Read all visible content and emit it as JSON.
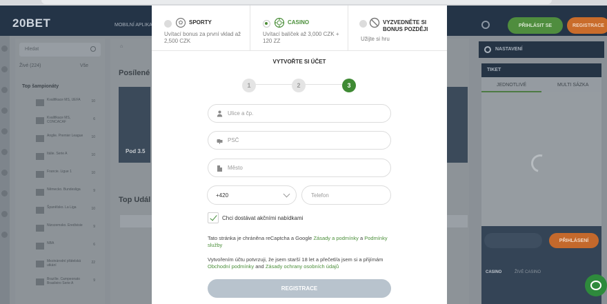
{
  "background": {
    "logo": "20BET",
    "nav_item": "MOBILNÍ APLIKACE",
    "login_button": "PŘIHLÁSIT SE",
    "register_button": "REGISTRACE",
    "sidebar": {
      "search_placeholder": "Hledat",
      "live_label": "Živé (224)",
      "live_all": "Vše",
      "top_leagues_heading": "Top šampionáty",
      "leagues": [
        {
          "name": "Kvalifikace MS, UEFA",
          "count": "10"
        },
        {
          "name": "Kvalifikace MS, CONCACAF",
          "count": "6"
        },
        {
          "name": "Anglie. Premier League",
          "count": "10"
        },
        {
          "name": "Itálie. Serie A",
          "count": "10"
        },
        {
          "name": "Francie. Ligue 1",
          "count": "10"
        },
        {
          "name": "Německo. Bundesliga",
          "count": "9"
        },
        {
          "name": "Španělsko. La Liga",
          "count": "10"
        },
        {
          "name": "Nizozemsko. Eredivisie",
          "count": "9"
        },
        {
          "name": "NBA",
          "count": "6"
        },
        {
          "name": "Mezinárodní přátelská utkání",
          "count": "22"
        },
        {
          "name": "Brazílie. Campeonato Brasileiro Serie A",
          "count": "9"
        }
      ]
    },
    "main": {
      "promo_title": "Posílené",
      "promo_card_text": "Pod 3.5",
      "events_title": "Top Udál"
    },
    "right": {
      "settings_label": "NASTAVENÍ",
      "ticket_label": "TIKET",
      "tab_single": "JEDNOTLIVÉ",
      "tab_multi": "MULTI SÁZKA",
      "login_button": "PŘIHLÁSENÍ",
      "casino_tab": "CASINO",
      "live_casino_tab": "ŽIVÉ CASINO"
    }
  },
  "modal": {
    "products": [
      {
        "title": "SPORTY",
        "desc": "Uvítací bonus za první vklad až 2,500 CZK",
        "selected": false,
        "icon": "soccer-ball-icon"
      },
      {
        "title": "CASINO",
        "desc": "Uvítací balíček až 3,000 CZK + 120 ZZ",
        "selected": true,
        "icon": "casino-chip-icon"
      },
      {
        "title": "VYZVEDNĚTE SI BONUS POZDĚJI",
        "desc": "Užijte si hru",
        "selected": false,
        "icon": "no-bonus-icon"
      }
    ],
    "step_title": "VYTVOŘTE SI ÚČET",
    "steps": [
      "1",
      "2",
      "3"
    ],
    "active_step": 3,
    "fields": {
      "street": {
        "placeholder": "Ulice a čp.",
        "value": "",
        "icon": "person-icon"
      },
      "zip": {
        "placeholder": "PSČ",
        "value": "",
        "icon": "mailbox-icon"
      },
      "city": {
        "placeholder": "Město",
        "value": "",
        "icon": "building-icon"
      },
      "phone_prefix": "+420",
      "phone": {
        "placeholder": "Telefon",
        "value": ""
      }
    },
    "offers_checkbox": {
      "label": "Chci dostávat akčními nabídkami",
      "checked": true
    },
    "recaptcha": {
      "prefix": "Tato stránka je chráněna reCaptcha a Google ",
      "link1": "Zásady a podmínky",
      "middle": " a ",
      "link2": "Podmínky služby"
    },
    "consent": {
      "prefix": "Vytvořením účtu potvrzuji, že jsem starší 18 let a přečetl/a jsem si a přijímám ",
      "link1": "Obchodní podmínky",
      "middle": " and ",
      "link2": "Zásady ochrany osobních údajů"
    },
    "submit_label": "REGISTRACE"
  },
  "colors": {
    "accent_green": "#3f8a34",
    "link_green": "#4b8f3a",
    "submit_disabled": "#b8c3cd",
    "overlay_dim": "#8a9096"
  }
}
